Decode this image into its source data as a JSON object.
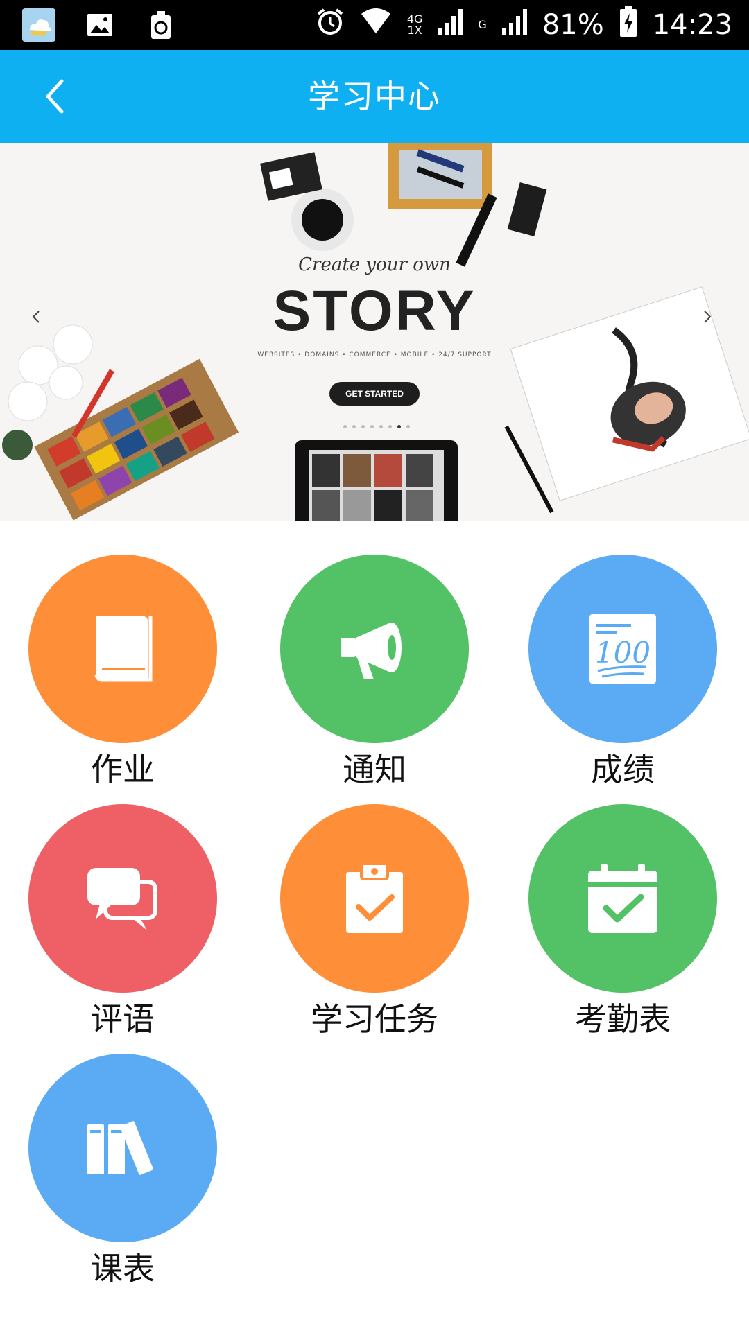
{
  "status_bar": {
    "battery": "81%",
    "time": "14:23",
    "net_4g": "4G",
    "net_1x": "1X",
    "net_g": "G",
    "icons": [
      "cloud-app-icon",
      "image-icon",
      "recycle-icon",
      "alarm-icon",
      "wifi-icon",
      "signal-icon",
      "battery-charging-icon"
    ]
  },
  "header": {
    "title": "学习中心",
    "back_icon": "chevron-left-icon"
  },
  "banner": {
    "subtitle": "Create your own",
    "title": "STORY",
    "tags": "WEBSITES • DOMAINS • COMMERCE • MOBILE • 24/7 SUPPORT",
    "button": "GET STARTED"
  },
  "menu": [
    {
      "label": "作业",
      "icon": "book-icon",
      "color": "#fe8e38"
    },
    {
      "label": "通知",
      "icon": "megaphone-icon",
      "color": "#53c166"
    },
    {
      "label": "成绩",
      "icon": "score-100-icon",
      "color": "#5aaaf4"
    },
    {
      "label": "评语",
      "icon": "chat-bubbles-icon",
      "color": "#ee6065"
    },
    {
      "label": "学习任务",
      "icon": "clipboard-check-icon",
      "color": "#fe8e38"
    },
    {
      "label": "考勤表",
      "icon": "calendar-check-icon",
      "color": "#53c166"
    },
    {
      "label": "课表",
      "icon": "books-icon",
      "color": "#5aaaf4"
    }
  ]
}
